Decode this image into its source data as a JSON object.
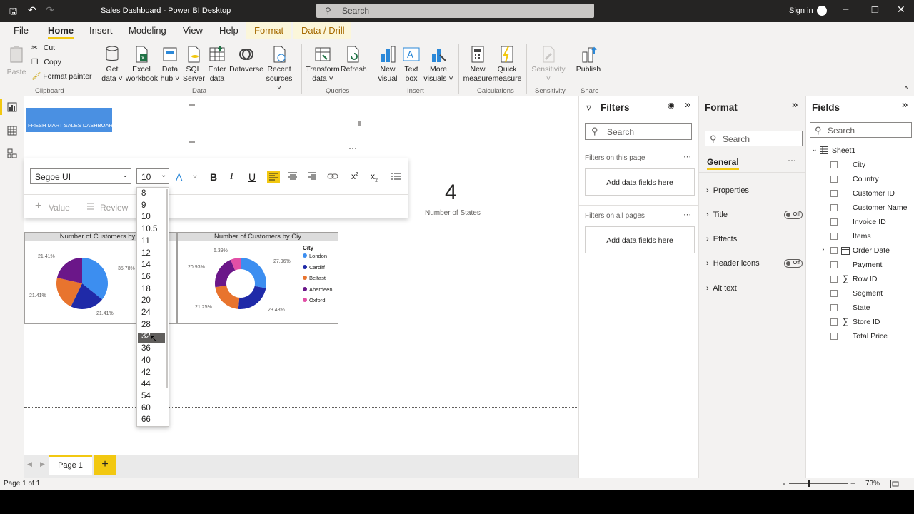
{
  "window": {
    "title": "Sales Dashboard - Power BI Desktop",
    "search_placeholder": "Search",
    "sign_in": "Sign in"
  },
  "menu_tabs": [
    "File",
    "Home",
    "Insert",
    "Modeling",
    "View",
    "Help",
    "Format",
    "Data / Drill"
  ],
  "ribbon": {
    "paste": "Paste",
    "cut": "Cut",
    "copy": "Copy",
    "format_painter": "Format painter",
    "get_data": [
      "Get",
      "data"
    ],
    "excel": [
      "Excel",
      "workbook"
    ],
    "data_hub": [
      "Data",
      "hub"
    ],
    "sql": [
      "SQL",
      "Server"
    ],
    "enter_data": [
      "Enter",
      "data"
    ],
    "dataverse": "Dataverse",
    "recent": [
      "Recent",
      "sources"
    ],
    "transform": [
      "Transform",
      "data"
    ],
    "refresh": "Refresh",
    "new_visual": [
      "New",
      "visual"
    ],
    "text_box": [
      "Text",
      "box"
    ],
    "more_visuals": [
      "More",
      "visuals"
    ],
    "new_measure": [
      "New",
      "measure"
    ],
    "quick_measure": [
      "Quick",
      "measure"
    ],
    "sensitivity": "Sensitivity",
    "publish": "Publish",
    "groups": [
      "Clipboard",
      "Data",
      "Queries",
      "Insert",
      "Calculations",
      "Sensitivity",
      "Share"
    ]
  },
  "canvas": {
    "textbox_label": "FRESH MART SALES DASHBOARD",
    "font_family": "Segoe UI",
    "font_size": "10",
    "value_btn": "Value",
    "review_btn": "Review",
    "font_sizes": [
      "8",
      "9",
      "10",
      "10.5",
      "11",
      "12",
      "14",
      "16",
      "18",
      "20",
      "24",
      "28",
      "32",
      "36",
      "40",
      "42",
      "44",
      "54",
      "60",
      "66"
    ],
    "highlighted_size": "32",
    "card": {
      "value": "4",
      "label": "Number of States"
    },
    "chart1_title": "Number of Customers by S",
    "chart2_title": "Number of Customers by Ciy",
    "legend_title": "City"
  },
  "chart_data": [
    {
      "type": "pie",
      "title": "Number of Customers by S",
      "labels": [
        "35.78%",
        "21.41%",
        "21.41%",
        "21.41%"
      ],
      "values": [
        35.78,
        21.41,
        21.41,
        21.41
      ],
      "colors": [
        "#3c8ef0",
        "#1f2aa8",
        "#e8742e",
        "#6b1789"
      ]
    },
    {
      "type": "pie",
      "title": "Number of Customers by Ciy",
      "categories": [
        "London",
        "Cardiff",
        "Belfast",
        "Aberdeen",
        "Oxford"
      ],
      "values": [
        27.96,
        23.48,
        21.25,
        20.93,
        6.39
      ],
      "labels": [
        "27.96%",
        "23.48%",
        "21.25%",
        "20.93%",
        "6.39%"
      ],
      "colors": [
        "#3c8ef0",
        "#1f2aa8",
        "#e8742e",
        "#6b1789",
        "#e24fa6"
      ]
    }
  ],
  "filters": {
    "title": "Filters",
    "search": "Search",
    "on_page": "Filters on this page",
    "on_all": "Filters on all pages",
    "add_fields": "Add data fields here"
  },
  "format_pane": {
    "title": "Format",
    "search": "Search",
    "tab": "General",
    "sections": [
      "Properties",
      "Title",
      "Effects",
      "Header icons",
      "Alt text"
    ],
    "off": "Off"
  },
  "fields_pane": {
    "title": "Fields",
    "search": "Search",
    "table": "Sheet1",
    "fields": [
      "City",
      "Country",
      "Customer ID",
      "Customer Name",
      "Invoice ID",
      "Items",
      "Order Date",
      "Payment",
      "Row ID",
      "Segment",
      "State",
      "Store ID",
      "Total Price"
    ]
  },
  "pages": {
    "page1": "Page 1",
    "add": "+"
  },
  "status": {
    "page": "Page 1 of 1",
    "zoom": "73%",
    "minus": "-",
    "plus": "+"
  }
}
